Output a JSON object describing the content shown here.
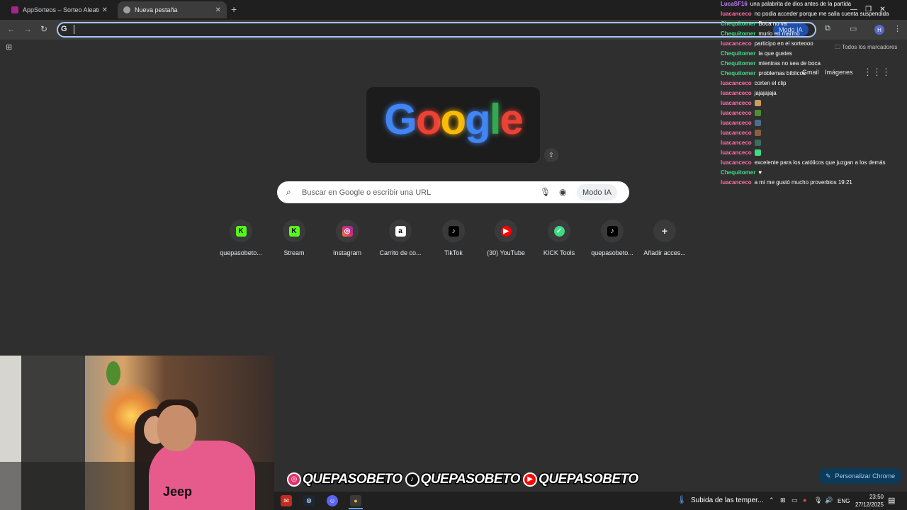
{
  "browser": {
    "tabs": [
      {
        "title": "AppSorteos – Sorteo Aleatorio",
        "favicon_color": "#a4268a"
      },
      {
        "title": "Nueva pestaña",
        "favicon_color": "#9aa0a6"
      }
    ],
    "omnibox": {
      "value": "",
      "ai_label": "Modo IA"
    },
    "bookmarks": {
      "all_label": "Todos los marcadores"
    },
    "profile_initial": "H"
  },
  "ntp": {
    "links": {
      "gmail": "Gmail",
      "images": "Imágenes"
    },
    "doodle_text": "Google",
    "search": {
      "placeholder": "Buscar en Google o escribir una URL",
      "ai_label": "Modo IA"
    },
    "shortcuts": [
      {
        "label": "quepasobeto...",
        "icon": "kick-icon",
        "color": "#53fc18",
        "glyph": "K"
      },
      {
        "label": "Stream",
        "icon": "kick-icon",
        "color": "#53fc18",
        "glyph": "K"
      },
      {
        "label": "Instagram",
        "icon": "instagram-icon",
        "color": "#e1306c",
        "glyph": "◎"
      },
      {
        "label": "Carrito de co...",
        "icon": "amazon-icon",
        "color": "#ffffff",
        "glyph": "a"
      },
      {
        "label": "TikTok",
        "icon": "tiktok-icon",
        "color": "#000000",
        "glyph": "♪"
      },
      {
        "label": "(30) YouTube",
        "icon": "youtube-icon",
        "color": "#ff0000",
        "glyph": "▶"
      },
      {
        "label": "KICK Tools",
        "icon": "check-icon",
        "color": "#3ddc84",
        "glyph": "✓"
      },
      {
        "label": "quepasobeto...",
        "icon": "tiktok-icon",
        "color": "#000000",
        "glyph": "♪"
      },
      {
        "label": "Añadir acces...",
        "icon": "plus-icon",
        "color": "#3a3a3a",
        "glyph": "+"
      }
    ],
    "customize_label": "Personalizar Chrome"
  },
  "chat": [
    {
      "user": "LucaSF16",
      "color": "#c77dff",
      "text": "una palabrita de dios antes de la partida"
    },
    {
      "user": "luacanceco",
      "color": "#ff6fa8",
      "text": "no podia acceder porque me salia cuenta suspendida"
    },
    {
      "user": "Chequitomer",
      "color": "#3ddc84",
      "text": "Boca no va"
    },
    {
      "user": "Chequitomer",
      "color": "#3ddc84",
      "text": "murio en marmo"
    },
    {
      "user": "luacanceco",
      "color": "#ff6fa8",
      "text": "participo en el sorteooo"
    },
    {
      "user": "Chequitomer",
      "color": "#3ddc84",
      "text": "la que gustes"
    },
    {
      "user": "Chequitomer",
      "color": "#3ddc84",
      "text": "mientras no sea de boca"
    },
    {
      "user": "Chequitomer",
      "color": "#3ddc84",
      "text": "problemas bíblicos"
    },
    {
      "user": "luacanceco",
      "color": "#ff6fa8",
      "text": "corten el clip"
    },
    {
      "user": "luacanceco",
      "color": "#ff6fa8",
      "text": "jajajajaja"
    },
    {
      "user": "luacanceco",
      "color": "#ff6fa8",
      "text": "",
      "emote": "#c9a15b"
    },
    {
      "user": "luacanceco",
      "color": "#ff6fa8",
      "text": "",
      "emote": "#4f8d2f"
    },
    {
      "user": "luacanceco",
      "color": "#ff6fa8",
      "text": "",
      "emote": "#4f6d8f"
    },
    {
      "user": "luacanceco",
      "color": "#ff6fa8",
      "text": "",
      "emote": "#8d5f3f"
    },
    {
      "user": "luacanceco",
      "color": "#ff6fa8",
      "text": "",
      "emote": "#3f6d5f"
    },
    {
      "user": "luacanceco",
      "color": "#ff6fa8",
      "text": "",
      "emote": "#3ddc84"
    },
    {
      "user": "luacanceco",
      "color": "#ff6fa8",
      "text": "excelente para los católicos que juzgan a los demás"
    },
    {
      "user": "Chequitomer",
      "color": "#3ddc84",
      "text": "♥"
    },
    {
      "user": "luacanceco",
      "color": "#ff6fa8",
      "text": "a mi me gustó mucho proverbios 19:21"
    }
  ],
  "overlay": {
    "handles": [
      {
        "text": "QUEPASOBETO",
        "icon": "instagram-icon",
        "glyph": "◎",
        "color": "#e1306c"
      },
      {
        "text": "QUEPASOBETO",
        "icon": "tiktok-icon",
        "glyph": "♪",
        "color": "#111111"
      },
      {
        "text": "QUEPASOBETO",
        "icon": "youtube-icon",
        "glyph": "▶",
        "color": "#ff0000"
      }
    ]
  },
  "taskbar": {
    "weather": "Subida de las temper...",
    "lang": "ENG",
    "time": "23:50",
    "date": "27/12/2025"
  }
}
